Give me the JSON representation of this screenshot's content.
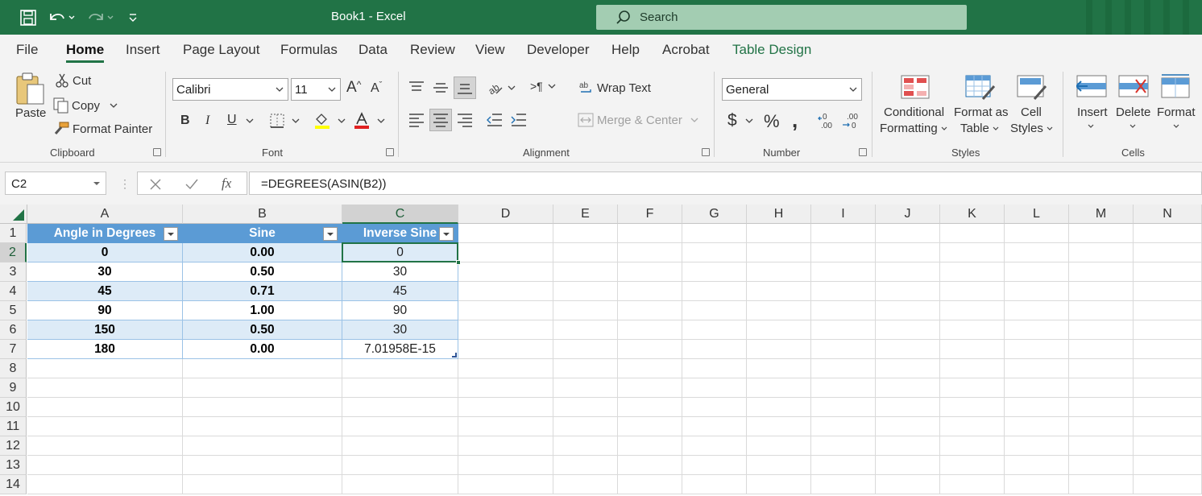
{
  "title_bar": {
    "doc_title": "Book1  -  Excel",
    "search_placeholder": "Search",
    "bg": "#217346"
  },
  "tabs": [
    "File",
    "Home",
    "Insert",
    "Page Layout",
    "Formulas",
    "Data",
    "Review",
    "View",
    "Developer",
    "Help",
    "Acrobat",
    "Table Design"
  ],
  "active_tab": "Home",
  "clipboard": {
    "paste": "Paste",
    "cut": "Cut",
    "copy": "Copy",
    "format_painter": "Format Painter",
    "label": "Clipboard"
  },
  "font": {
    "family": "Calibri",
    "size": "11",
    "bold": "B",
    "italic": "I",
    "underline": "U",
    "label": "Font"
  },
  "alignment": {
    "wrap_text": "Wrap Text",
    "merge_center": "Merge & Center",
    "label": "Alignment"
  },
  "number": {
    "format": "General",
    "label": "Number"
  },
  "styles": {
    "conditional_1": "Conditional",
    "conditional_2": "Formatting",
    "format_table_1": "Format as",
    "format_table_2": "Table",
    "cell_styles_1": "Cell",
    "cell_styles_2": "Styles",
    "label": "Styles"
  },
  "cells": {
    "insert": "Insert",
    "delete": "Delete",
    "format": "Format",
    "label": "Cells"
  },
  "formula_bar": {
    "name_box": "C2",
    "formula": "=DEGREES(ASIN(B2))",
    "fx": "fx"
  },
  "columns": [
    "A",
    "B",
    "C",
    "D",
    "E",
    "F",
    "G",
    "H",
    "I",
    "J",
    "K",
    "L",
    "M",
    "N"
  ],
  "rows": [
    "1",
    "2",
    "3",
    "4",
    "5",
    "6",
    "7",
    "8",
    "9",
    "10",
    "11",
    "12",
    "13",
    "14"
  ],
  "table": {
    "headers": [
      "Angle in Degrees",
      "Sine",
      "Inverse Sine"
    ],
    "data": [
      [
        "0",
        "0.00",
        "0"
      ],
      [
        "30",
        "0.50",
        "30"
      ],
      [
        "45",
        "0.71",
        "45"
      ],
      [
        "90",
        "1.00",
        "90"
      ],
      [
        "150",
        "0.50",
        "30"
      ],
      [
        "180",
        "0.00",
        "7.01958E-15"
      ]
    ]
  },
  "colors": {
    "excel_green": "#217346",
    "table_header": "#5b9bd5",
    "band": "#ddebf7"
  }
}
